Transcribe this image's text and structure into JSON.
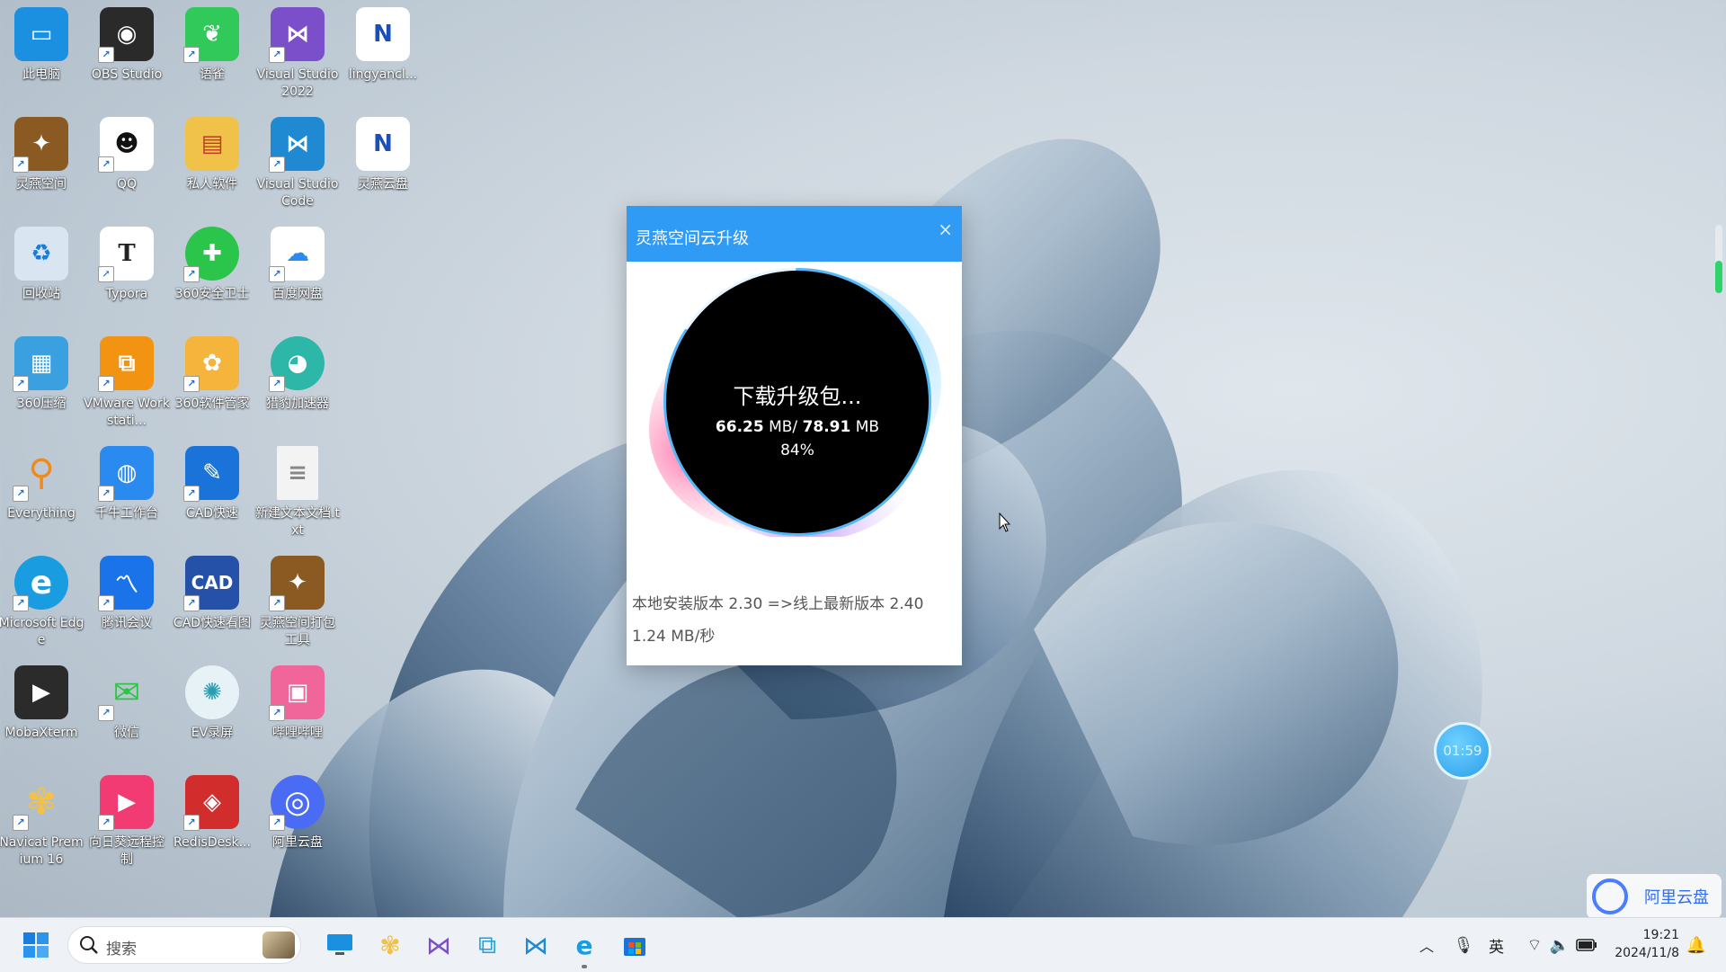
{
  "desktop": {
    "icons": [
      {
        "label": "此电脑",
        "color": "#1b8fe0",
        "glyph": "▭"
      },
      {
        "label": "OBS Studio",
        "color": "#2a2a2a",
        "glyph": "◉"
      },
      {
        "label": "语雀",
        "color": "#31c95a",
        "glyph": "❦"
      },
      {
        "label": "Visual Studio 2022",
        "color": "#7a4fc9",
        "glyph": "⋈"
      },
      {
        "label": "lingyancl...",
        "color": "#ffffff",
        "glyph": "N"
      },
      {
        "label": "灵燕空间",
        "color": "#8a5a22",
        "glyph": "✦"
      },
      {
        "label": "QQ",
        "color": "#ffffff",
        "glyph": "☻"
      },
      {
        "label": "私人软件",
        "color": "#f1c24a",
        "glyph": "▤"
      },
      {
        "label": "Visual Studio Code",
        "color": "#1f8ad2",
        "glyph": "⋈"
      },
      {
        "label": "灵燕云盘",
        "color": "#ffffff",
        "glyph": "N"
      },
      {
        "label": "回收站",
        "color": "#d9e6f2",
        "glyph": "♻"
      },
      {
        "label": "Typora",
        "color": "#ffffff",
        "glyph": "T"
      },
      {
        "label": "360安全卫士",
        "color": "#2cc54b",
        "glyph": "✚"
      },
      {
        "label": "百度网盘",
        "color": "#ffffff",
        "glyph": "☁"
      },
      {
        "label": "360压缩",
        "color": "#3aa0e0",
        "glyph": "▦"
      },
      {
        "label": "VMware Workstati...",
        "color": "#f29312",
        "glyph": "⧉"
      },
      {
        "label": "360软件管家",
        "color": "#f5b43c",
        "glyph": "✿"
      },
      {
        "label": "猎豹加速器",
        "color": "#2db7a8",
        "glyph": "◕"
      },
      {
        "label": "Everything",
        "color": "#f08a1c",
        "glyph": "⚲"
      },
      {
        "label": "千牛工作台",
        "color": "#2a8af0",
        "glyph": "◍"
      },
      {
        "label": "CAD快速",
        "color": "#1a73d9",
        "glyph": "✎"
      },
      {
        "label": "新建文本文档.txt",
        "color": "#f3f3f3",
        "glyph": "≡"
      },
      {
        "label": "Microsoft Edge",
        "color": "#1a9de0",
        "glyph": "e"
      },
      {
        "label": "腾讯会议",
        "color": "#1a73e8",
        "glyph": "〽"
      },
      {
        "label": "CAD快速看图",
        "color": "#2552a8",
        "glyph": "CAD"
      },
      {
        "label": "灵燕空间打包工具",
        "color": "#8a5a22",
        "glyph": "✦"
      },
      {
        "label": "MobaXterm",
        "color": "#2b2b2b",
        "glyph": "▶"
      },
      {
        "label": "微信",
        "color": "#2cc542",
        "glyph": "✉"
      },
      {
        "label": "EV录屏",
        "color": "#e6f2f5",
        "glyph": "✺"
      },
      {
        "label": "哔哩哔哩",
        "color": "#f0659a",
        "glyph": "▣"
      },
      {
        "label": "Navicat Premium 16",
        "color": "#f2c14a",
        "glyph": "✾"
      },
      {
        "label": "向日葵远程控制",
        "color": "#f23b72",
        "glyph": "▶"
      },
      {
        "label": "RedisDesk...",
        "color": "#d22d2d",
        "glyph": "◈"
      },
      {
        "label": "阿里云盘",
        "color": "#4a6cf5",
        "glyph": "◎"
      }
    ]
  },
  "dialog": {
    "title": "灵燕空间云升级",
    "close_glyph": "×",
    "status": "下载升级包...",
    "downloaded": "66.25",
    "unit1": "MB/",
    "total": "78.91",
    "unit2": "MB",
    "percent_text": "84%",
    "progress": 0.84,
    "version_text": "本地安装版本 2.30 =>线上最新版本 2.40",
    "speed_text": "1.24 MB/秒"
  },
  "floating": {
    "timer": "01:59",
    "aliyun_label": "阿里云盘"
  },
  "taskbar": {
    "search_placeholder": "搜索",
    "ime": "英",
    "time": "19:21",
    "date": "2024/11/8"
  },
  "colors": {
    "dialog_header": "#2f9bf5",
    "accent": "#2f6cf4"
  }
}
